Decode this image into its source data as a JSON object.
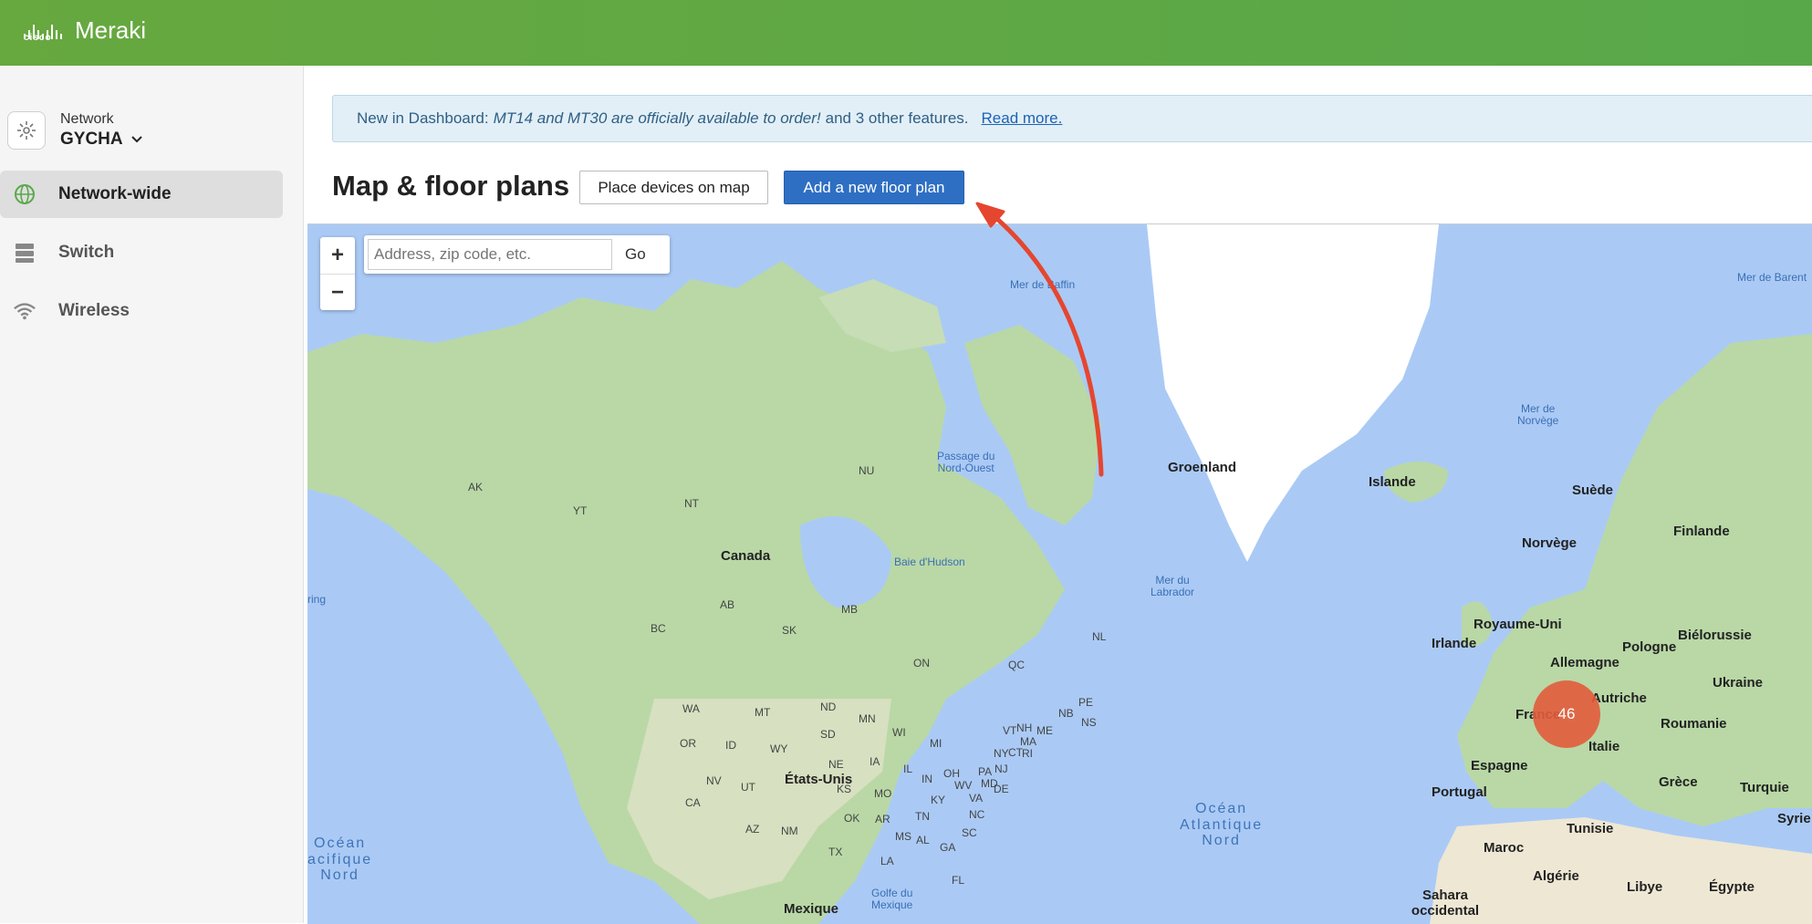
{
  "brand": {
    "company": "cisco",
    "product": "Meraki"
  },
  "sidebar": {
    "network_label": "Network",
    "network_name": "GYCHA",
    "items": [
      {
        "label": "Network-wide",
        "icon": "globe-icon",
        "active": true
      },
      {
        "label": "Switch",
        "icon": "switch-icon",
        "active": false
      },
      {
        "label": "Wireless",
        "icon": "wifi-icon",
        "active": false
      }
    ]
  },
  "banner": {
    "prefix": "New in Dashboard:",
    "message": "MT14 and MT30 are officially available to order!",
    "suffix": "and 3 other features.",
    "link": "Read more."
  },
  "page": {
    "title": "Map & floor plans",
    "place_devices_button": "Place devices on map",
    "add_floor_plan_button": "Add a new floor plan"
  },
  "map": {
    "zoom_in": "+",
    "zoom_out": "−",
    "search_placeholder": "Address, zip code, etc.",
    "go_label": "Go",
    "cluster_count": "46",
    "labels": {
      "groenland": "Groenland",
      "islande": "Islande",
      "canada": "Canada",
      "etats_unis": "États-Unis",
      "mexique": "Mexique",
      "suede": "Suède",
      "norvege": "Norvège",
      "finlande": "Finlande",
      "royaume_uni": "Royaume-Uni",
      "irlande": "Irlande",
      "allemagne": "Allemagne",
      "pologne": "Pologne",
      "bielorussie": "Biélorussie",
      "ukraine": "Ukraine",
      "autriche": "Autriche",
      "france": "France",
      "roumanie": "Roumanie",
      "italie": "Italie",
      "espagne": "Espagne",
      "portugal": "Portugal",
      "grece": "Grèce",
      "turquie": "Turquie",
      "tunisie": "Tunisie",
      "maroc": "Maroc",
      "algerie": "Algérie",
      "libye": "Libye",
      "egypte": "Égypte",
      "syrie": "Syrie",
      "sahara_occidental": "Sahara occidental"
    },
    "regions": {
      "ak": "AK",
      "yt": "YT",
      "nt": "NT",
      "nu": "NU",
      "bc": "BC",
      "ab": "AB",
      "sk": "SK",
      "mb": "MB",
      "on": "ON",
      "qc": "QC",
      "nl": "NL",
      "nb": "NB",
      "ns": "NS",
      "pe": "PE",
      "wa": "WA",
      "mt": "MT",
      "nd": "ND",
      "mn": "MN",
      "or": "OR",
      "id": "ID",
      "sd": "SD",
      "wy": "WY",
      "wi": "WI",
      "mi": "MI",
      "ne": "NE",
      "ia": "IA",
      "nv": "NV",
      "ut": "UT",
      "ca": "CA",
      "mo": "MO",
      "ks": "KS",
      "il": "IL",
      "in": "IN",
      "oh": "OH",
      "pa": "PA",
      "ny": "NY",
      "az": "AZ",
      "nm": "NM",
      "ok": "OK",
      "ar": "AR",
      "tn": "TN",
      "tx": "TX",
      "la": "LA",
      "ms": "MS",
      "al": "AL",
      "ga": "GA",
      "sc": "SC",
      "nc": "NC",
      "va": "VA",
      "ky": "KY",
      "wv": "WV",
      "md": "MD",
      "de": "DE",
      "nj": "NJ",
      "ct": "CT",
      "ri": "RI",
      "ma": "MA",
      "nh": "NH",
      "vt": "VT",
      "me": "ME",
      "fl": "FL"
    },
    "water": {
      "mer_de_baffin": "Mer de Baffin",
      "mer_de_barents": "Mer de Barent",
      "mer_de_norvege": "Mer de\nNorvège",
      "passage": "Passage du\nNord-Ouest",
      "baie_hudson": "Baie d'Hudson",
      "mer_labrador": "Mer du\nLabrador",
      "golfe_mexique": "Golfe du\nMexique",
      "bering": "ring",
      "ocean_atlantique": "Océan\nAtlantique\nNord",
      "ocean_pacifique": "Océan\nacifique\nNord"
    }
  },
  "annotation": {
    "arrow_color": "#e5462f"
  }
}
